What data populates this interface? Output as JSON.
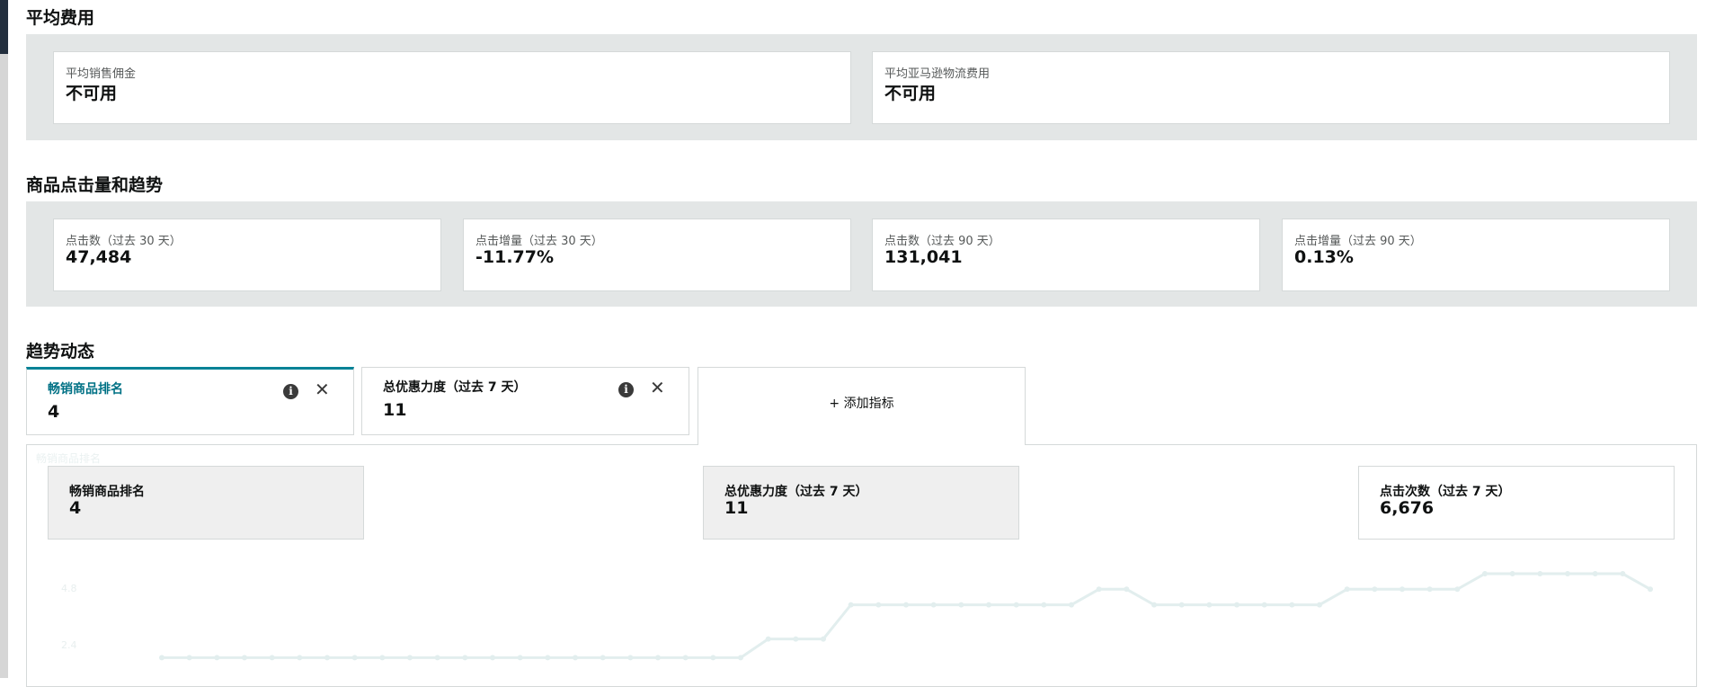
{
  "avg_fees": {
    "title": "平均费用",
    "cards": [
      {
        "label": "平均销售佣金",
        "value": "不可用"
      },
      {
        "label": "平均亚马逊物流费用",
        "value": "不可用"
      }
    ]
  },
  "clicks": {
    "title": "商品点击量和趋势",
    "cards": [
      {
        "label": "点击数（过去 30 天）",
        "value": "47,484"
      },
      {
        "label": "点击增量（过去 30 天）",
        "value": "-11.77%"
      },
      {
        "label": "点击数（过去 90 天）",
        "value": "131,041"
      },
      {
        "label": "点击增量（过去 90 天）",
        "value": "0.13%"
      }
    ]
  },
  "trends": {
    "title": "趋势动态",
    "tabs": [
      {
        "label": "畅销商品排名",
        "value": "4"
      },
      {
        "label": "总优惠力度（过去 7 天）",
        "value": "11"
      }
    ],
    "add_metric_label": "+ 添加指标",
    "chart": {
      "faint_title": "畅销商品排名",
      "legend": [
        {
          "label": "畅销商品排名",
          "value": "4"
        },
        {
          "label": "总优惠力度（过去 7 天）",
          "value": "11"
        },
        {
          "label": "点击次数（过去 7 天）",
          "value": "6,676"
        }
      ],
      "y_ticks": [
        "4.8",
        "2.4"
      ]
    }
  },
  "colors": {
    "accent": "#008296",
    "panel": "#e3e6e6",
    "line_faint": "#e2eeee"
  },
  "icons": {
    "info": "info-icon",
    "close": "close-icon"
  },
  "chart_data": {
    "type": "line",
    "ylim": [
      0,
      6
    ],
    "x": [
      1,
      2,
      3,
      4,
      5,
      6,
      7,
      8,
      9,
      10,
      11,
      12,
      13,
      14,
      15,
      16,
      17,
      18,
      19,
      20,
      21,
      22,
      23,
      24,
      25,
      26,
      27,
      28,
      29,
      30,
      31,
      32,
      33,
      34,
      35,
      36,
      37,
      38,
      39,
      40,
      41,
      42,
      43,
      44,
      45,
      46,
      47,
      48,
      49,
      50,
      51,
      52,
      53,
      54,
      55
    ],
    "values": [
      0.8,
      0.8,
      0.8,
      0.8,
      0.8,
      0.8,
      0.8,
      0.8,
      0.8,
      0.8,
      0.8,
      0.8,
      0.8,
      0.8,
      0.8,
      0.8,
      0.8,
      0.8,
      0.8,
      0.8,
      0.8,
      0.8,
      1.4,
      1.4,
      1.4,
      2.5,
      2.5,
      2.5,
      2.5,
      2.5,
      2.5,
      2.5,
      2.5,
      2.5,
      3.0,
      3.0,
      2.5,
      2.5,
      2.5,
      2.5,
      2.5,
      2.5,
      2.5,
      3.0,
      3.0,
      3.0,
      3.0,
      3.0,
      3.5,
      3.5,
      3.5,
      3.5,
      3.5,
      3.5,
      3.0
    ]
  }
}
